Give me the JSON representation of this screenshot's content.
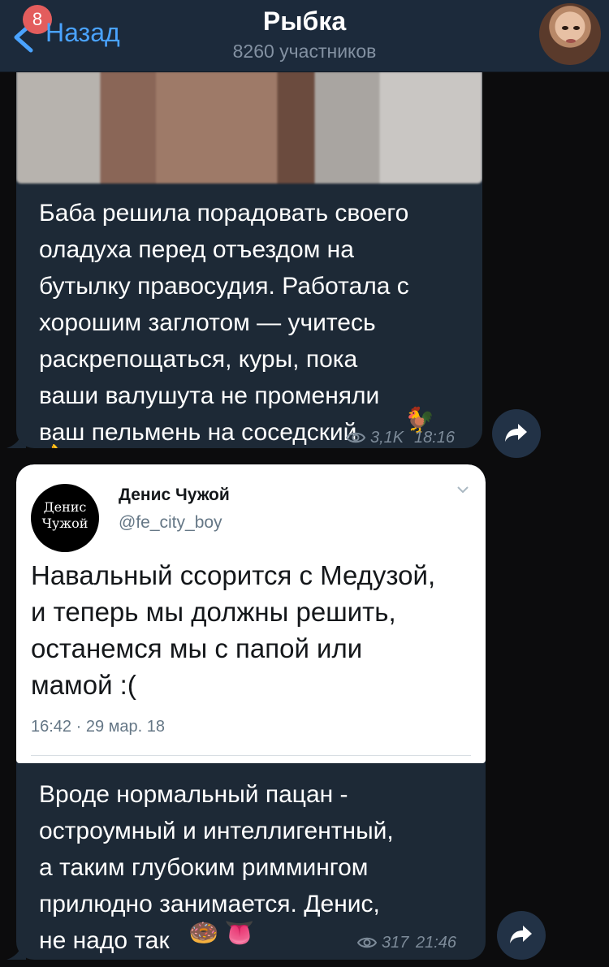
{
  "header": {
    "back_label": "Назад",
    "back_badge": "8",
    "title": "Рыбка",
    "subtitle": "8260 участников"
  },
  "message1": {
    "text": "Баба решила порадовать своего\nоладуха перед отъездом на\nбутылку правосудия. Работала с\nхорошим заглотом — учитесь\nраскрепощаться, куры, пока\nваши валушута не променяли\nваш пельмень на соседский",
    "emoji_rooster": "🐓",
    "emoji_ok": "👌",
    "views": "3,1K",
    "time": "18:16"
  },
  "message2": {
    "tweet": {
      "avatar_line1": "Денис",
      "avatar_line2": "Чужой",
      "name": "Денис Чужой",
      "handle": "@fe_city_boy",
      "text": "Навальный ссорится с Медузой,\nи теперь мы должны решить,\nостанемся мы с папой или\nмамой :(",
      "timestamp": "16:42 · 29 мар. 18"
    },
    "text": "Вроде нормальный пацан -\nостроумный и интеллигентный,\nа таким глубоким риммингом\nприлюдно занимается. Денис,\nне надо так",
    "emoji_donut": "🍩",
    "emoji_tongue": "👅",
    "views": "317",
    "time": "21:46"
  },
  "colors": {
    "header_bg": "#1c2a3b",
    "bubble_bg": "#1d2936",
    "accent": "#4aa3ff",
    "badge": "#e35d5d",
    "meta": "#7d8b99"
  },
  "icons": [
    "back-chevron-icon",
    "eye-icon",
    "forward-icon",
    "chevron-down-icon"
  ]
}
